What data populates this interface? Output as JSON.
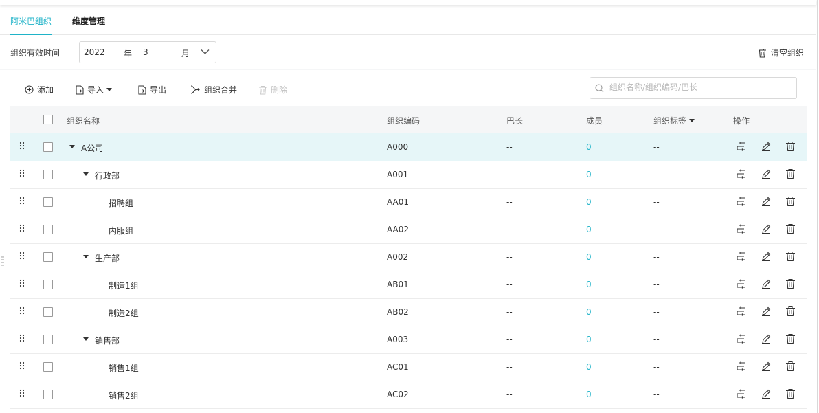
{
  "tabs": [
    {
      "label": "阿米巴组织",
      "active": true
    },
    {
      "label": "维度管理",
      "active": false
    }
  ],
  "filter": {
    "label": "组织有效时间",
    "year": "2022",
    "year_unit": "年",
    "month": "3",
    "month_unit": "月"
  },
  "clear_label": "清空组织",
  "toolbar": {
    "add": "添加",
    "import": "导入",
    "export": "导出",
    "merge": "组织合并",
    "delete": "删除",
    "search_placeholder": "组织名称/组织编码/巴长"
  },
  "columns": {
    "name": "组织名称",
    "code": "组织编码",
    "leader": "巴长",
    "members": "成员",
    "tags": "组织标签",
    "ops": "操作"
  },
  "rows": [
    {
      "name": "A公司",
      "code": "A000",
      "leader": "--",
      "members": "0",
      "tags": "--"
    },
    {
      "name": "行政部",
      "code": "A001",
      "leader": "--",
      "members": "0",
      "tags": "--"
    },
    {
      "name": "招聘组",
      "code": "AA01",
      "leader": "--",
      "members": "0",
      "tags": "--"
    },
    {
      "name": "内服组",
      "code": "AA02",
      "leader": "--",
      "members": "0",
      "tags": "--"
    },
    {
      "name": "生产部",
      "code": "A002",
      "leader": "--",
      "members": "0",
      "tags": "--"
    },
    {
      "name": "制造1组",
      "code": "AB01",
      "leader": "--",
      "members": "0",
      "tags": "--"
    },
    {
      "name": "制造2组",
      "code": "AB02",
      "leader": "--",
      "members": "0",
      "tags": "--"
    },
    {
      "name": "销售部",
      "code": "A003",
      "leader": "--",
      "members": "0",
      "tags": "--"
    },
    {
      "name": "销售1组",
      "code": "AC01",
      "leader": "--",
      "members": "0",
      "tags": "--"
    },
    {
      "name": "销售2组",
      "code": "AC02",
      "leader": "--",
      "members": "0",
      "tags": "--"
    }
  ],
  "colors": {
    "accent": "#1fb3c8",
    "highlight_row": "#e6f6f8"
  }
}
